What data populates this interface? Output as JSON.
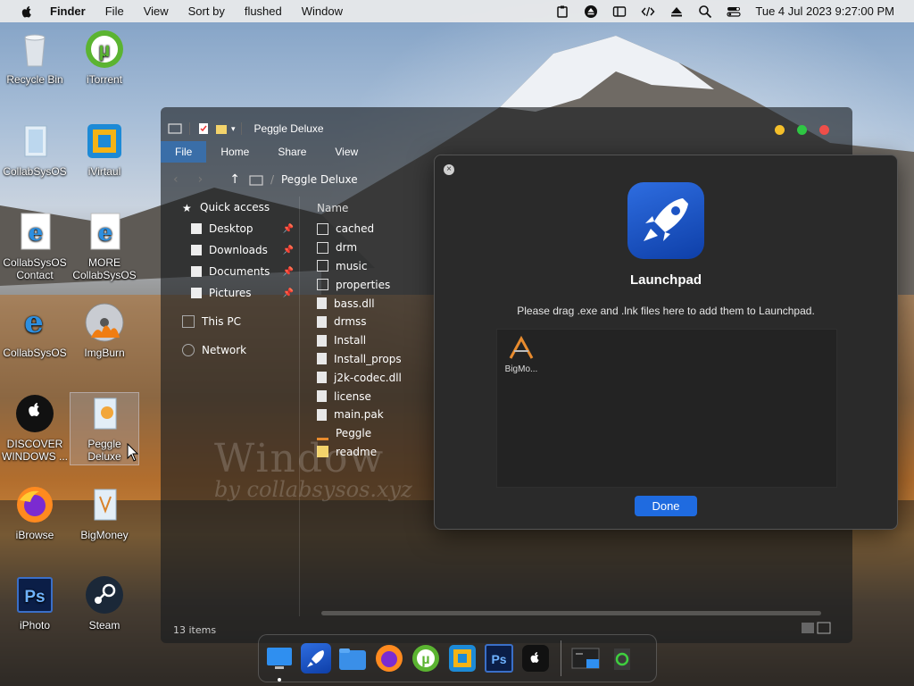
{
  "menubar": {
    "app_name": "Finder",
    "items": [
      "File",
      "View",
      "Sort by",
      "flushed",
      "Window"
    ],
    "datetime": "Tue 4 Jul 2023  9:27:00 PM"
  },
  "desktop_icons": [
    {
      "label": "Recycle Bin",
      "icon": "trash-icon"
    },
    {
      "label": "iTorrent",
      "icon": "utorrent-icon"
    },
    {
      "label": "CollabSysOS",
      "icon": "folder-icon"
    },
    {
      "label": "iVirtaul",
      "icon": "virtual-icon"
    },
    {
      "label": "CollabSysOS Contact",
      "icon": "ie-icon"
    },
    {
      "label": "MORE CollabSysOS",
      "icon": "ie-icon"
    },
    {
      "label": "CollabSysOS",
      "icon": "ie-icon"
    },
    {
      "label": "ImgBurn",
      "icon": "disc-icon"
    },
    {
      "label": "DISCOVER WINDOWS ...",
      "icon": "apple-icon"
    },
    {
      "label": "Peggle Deluxe",
      "icon": "folder-icon"
    },
    {
      "label": "iBrowse",
      "icon": "firefox-icon"
    },
    {
      "label": "BigMoney",
      "icon": "folder-icon"
    },
    {
      "label": "iPhoto",
      "icon": "photoshop-icon"
    },
    {
      "label": "Steam",
      "icon": "steam-icon"
    }
  ],
  "explorer": {
    "title": "Peggle Deluxe",
    "ribbon_tabs": [
      "File",
      "Home",
      "Share",
      "View"
    ],
    "breadcrumb": "Peggle Deluxe",
    "nav": {
      "quick_access": "Quick access",
      "pinned": [
        "Desktop",
        "Downloads",
        "Documents",
        "Pictures"
      ],
      "this_pc": "This PC",
      "network": "Network"
    },
    "column_name": "Name",
    "files": [
      {
        "name": "cached",
        "type": "folder"
      },
      {
        "name": "drm",
        "type": "folder"
      },
      {
        "name": "music",
        "type": "folder"
      },
      {
        "name": "properties",
        "type": "folder"
      },
      {
        "name": "bass.dll",
        "type": "file"
      },
      {
        "name": "drmss",
        "type": "file"
      },
      {
        "name": "Install",
        "type": "file"
      },
      {
        "name": "Install_props",
        "type": "file"
      },
      {
        "name": "j2k-codec.dll",
        "type": "file"
      },
      {
        "name": "license",
        "type": "file"
      },
      {
        "name": "main.pak",
        "type": "file"
      },
      {
        "name": "Peggle",
        "type": "app"
      },
      {
        "name": "readme",
        "type": "note"
      }
    ],
    "status": "13 items",
    "watermark_line1": "Window",
    "watermark_line2": "by collabsysos.xyz"
  },
  "dialog": {
    "title": "Launchpad",
    "message": "Please drag .exe and .lnk files here to add them to Launchpad.",
    "drop_item_label": "BigMo...",
    "done_label": "Done"
  },
  "dock": {
    "apps": [
      "finder-icon",
      "launchpad-icon",
      "files-icon",
      "firefox-icon",
      "utorrent-icon",
      "virtual-icon",
      "photoshop-icon",
      "apple-icon"
    ],
    "extras": [
      "terminal-icon",
      "recycle-icon"
    ]
  },
  "colors": {
    "accent_blue": "#1f6be0",
    "ribbon_active": "#3a6ea8",
    "dialog_bg": "#2a2a2a"
  }
}
